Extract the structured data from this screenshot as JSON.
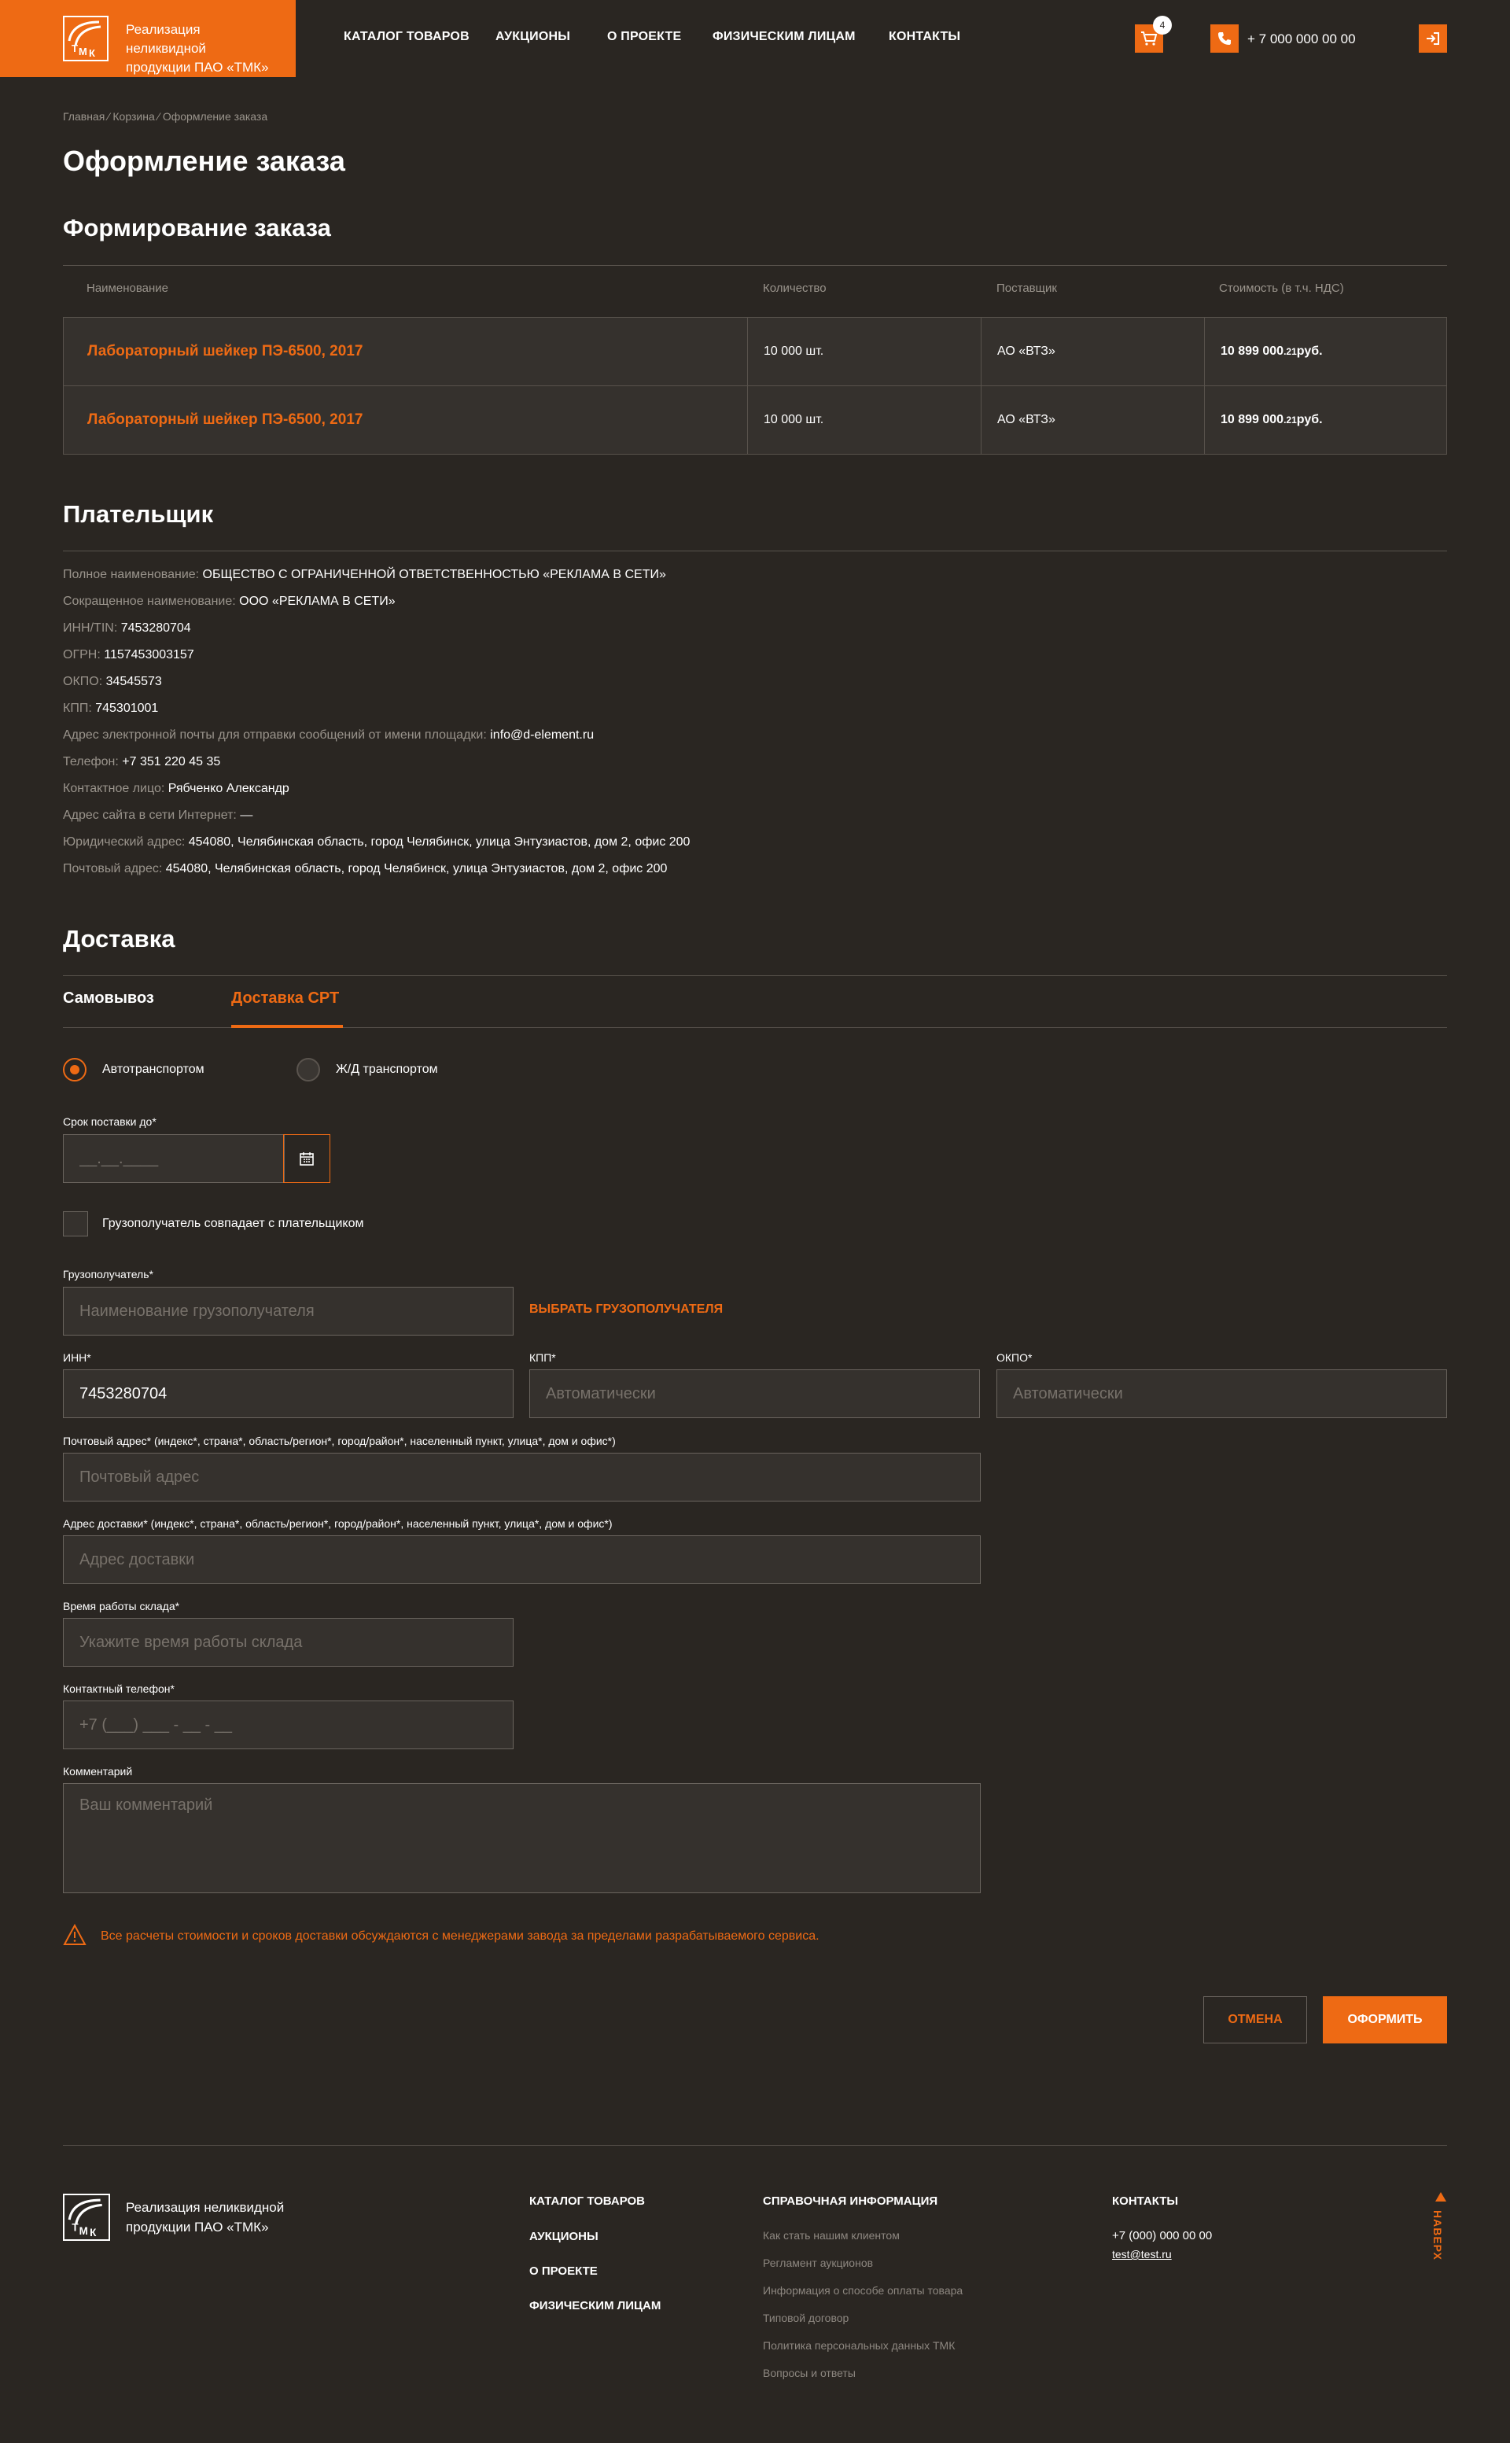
{
  "header": {
    "logo_text_line1": "Реализация неликвидной",
    "logo_text_line2": "продукции ПАО «ТМК»",
    "nav": [
      "КАТАЛОГ ТОВАРОВ",
      "АУКЦИОНЫ",
      "О ПРОЕКТЕ",
      "ФИЗИЧЕСКИМ ЛИЦАМ",
      "КОНТАКТЫ"
    ],
    "cart_count": "4",
    "phone": "+ 7 000 000 00 00"
  },
  "breadcrumb": "Главная  ⁄  Корзина  ⁄  Оформление заказа",
  "page_title": "Оформление заказа",
  "order": {
    "title": "Формирование заказа",
    "columns": [
      "Наименование",
      "Количество",
      "Поставщик",
      "Стоимость (в т.ч. НДС)"
    ],
    "rows": [
      {
        "name": "Лабораторный шейкер ПЭ-6500, 2017",
        "qty": "10 000 шт.",
        "supplier": "АО «ВТЗ»",
        "price_main": "10 899 000",
        "price_cents": ".21",
        "price_unit": " руб."
      },
      {
        "name": "Лабораторный шейкер ПЭ-6500, 2017",
        "qty": "10 000 шт.",
        "supplier": "АО «ВТЗ»",
        "price_main": "10 899 000",
        "price_cents": ".21",
        "price_unit": " руб."
      }
    ]
  },
  "payer": {
    "title": "Плательщик",
    "fields": [
      {
        "label": "Полное наименование: ",
        "value": "ОБЩЕСТВО С ОГРАНИЧЕННОЙ ОТВЕТСТВЕННОСТЬЮ «РЕКЛАМА В СЕТИ»"
      },
      {
        "label": "Сокращенное наименование: ",
        "value": "ООО «РЕКЛАМА В СЕТИ»"
      },
      {
        "label": "ИНН/TIN: ",
        "value": "7453280704"
      },
      {
        "label": "ОГРН: ",
        "value": "1157453003157"
      },
      {
        "label": "ОКПО: ",
        "value": "34545573"
      },
      {
        "label": "КПП: ",
        "value": "745301001"
      },
      {
        "label": "Адрес электронной почты для отправки сообщений от имени площадки: ",
        "value": "info@d-element.ru"
      },
      {
        "label": "Телефон: ",
        "value": "+7 351 220 45 35"
      },
      {
        "label": "Контактное лицо: ",
        "value": "Рябченко Александр"
      },
      {
        "label": "Адрес сайта в сети Интернет: ",
        "value": "—"
      },
      {
        "label": "Юридический адрес: ",
        "value": "454080, Челябинская область, город Челябинск, улица Энтузиастов, дом 2, офис 200"
      },
      {
        "label": "Почтовый адрес: ",
        "value": "454080, Челябинская область, город Челябинск, улица Энтузиастов, дом 2, офис 200"
      }
    ]
  },
  "delivery": {
    "title": "Доставка",
    "tabs": [
      "Самовывоз",
      "Доставка СРТ"
    ],
    "transport": [
      "Автотранспортом",
      "Ж/Д транспортом"
    ],
    "deadline_label": "Срок поставки до*",
    "deadline_placeholder": "__.__.____",
    "same_as_payer": "Грузополучатель совпадает с плательщиком",
    "consignee_label": "Грузополучатель*",
    "consignee_placeholder": "Наименование грузополучателя",
    "choose_consignee": "ВЫБРАТЬ ГРУЗОПОЛУЧАТЕЛЯ",
    "inn_label": "ИНН*",
    "inn_value": "7453280704",
    "kpp_label": "КПП*",
    "kpp_placeholder": "Автоматически",
    "okpo_label": "ОКПО*",
    "okpo_placeholder": "Автоматически",
    "postal_label": "Почтовый адрес* (индекс*, страна*, область/регион*, город/район*, населенный пункт, улица*, дом и офис*)",
    "postal_placeholder": "Почтовый адрес",
    "delivery_addr_label": "Адрес доставки* (индекс*, страна*, область/регион*, город/район*, населенный пункт, улица*, дом и офис*)",
    "delivery_addr_placeholder": "Адрес доставки",
    "hours_label": "Время работы склада*",
    "hours_placeholder": "Укажите время работы склада",
    "phone_label": "Контактный телефон*",
    "phone_placeholder": "+7 (___) ___ - __ - __",
    "comment_label": "Комментарий",
    "comment_placeholder": "Ваш комментарий",
    "warning": "Все расчеты стоимости и сроков доставки обсуждаются с менеджерами завода за пределами разрабатываемого сервиса.",
    "cancel": "ОТМЕНА",
    "submit": "ОФОРМИТЬ"
  },
  "footer": {
    "logo_text_line1": "Реализация неликвидной",
    "logo_text_line2": "продукции ПАО «ТМК»",
    "menu": [
      "КАТАЛОГ ТОВАРОВ",
      "АУКЦИОНЫ",
      "О ПРОЕКТЕ",
      "ФИЗИЧЕСКИМ ЛИЦАМ"
    ],
    "info_title": "СПРАВОЧНАЯ ИНФОРМАЦИЯ",
    "info_links": [
      "Как стать нашим клиентом",
      "Регламент аукционов",
      "Информация о способе оплаты товара",
      "Типовой договор",
      "Политика персональных данных ТМК",
      "Вопросы и ответы"
    ],
    "contacts_title": "КОНТАКТЫ",
    "contacts_phone": "+7 (000) 000 00 00",
    "contacts_email": "test@test.ru",
    "to_top": "НАВЕРХ"
  },
  "colors": {
    "accent": "#ee6a14",
    "background": "#2a2622",
    "row": "#35312d"
  }
}
